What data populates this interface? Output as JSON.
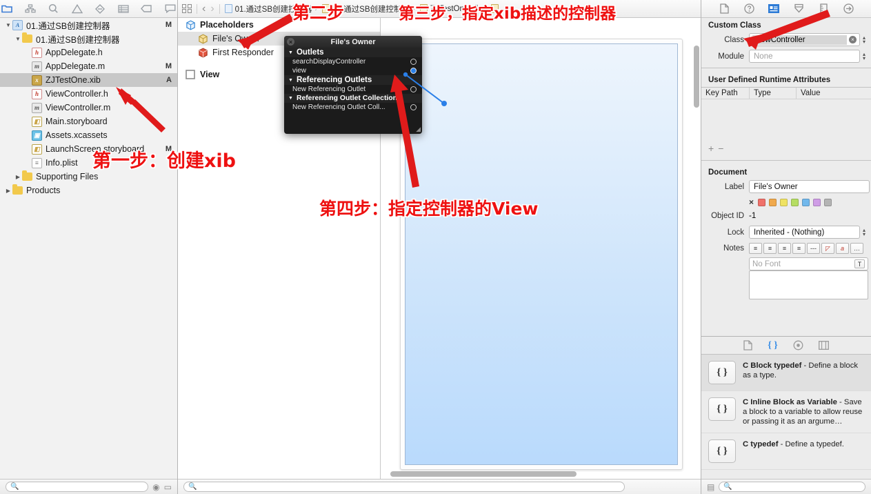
{
  "navigator": {
    "toolbar_icons": [
      "folder-icon",
      "hierarchy-icon",
      "search-icon",
      "warning-icon",
      "issue-icon",
      "test-icon",
      "debug-icon",
      "report-icon"
    ],
    "rows": [
      {
        "name": "01.通过SB创建控制器",
        "status": "M",
        "depth": 0,
        "twisty": "▼",
        "icon": "project-icon"
      },
      {
        "name": "01.通过SB创建控制器",
        "status": "",
        "depth": 1,
        "twisty": "▼",
        "icon": "folder-icon"
      },
      {
        "name": "AppDelegate.h",
        "status": "",
        "depth": 2,
        "twisty": "",
        "icon": "header-file-icon"
      },
      {
        "name": "AppDelegate.m",
        "status": "M",
        "depth": 2,
        "twisty": "",
        "icon": "objc-file-icon"
      },
      {
        "name": "ZJTestOne.xib",
        "status": "A",
        "depth": 2,
        "twisty": "",
        "icon": "xib-file-icon",
        "selected": true
      },
      {
        "name": "ViewController.h",
        "status": "",
        "depth": 2,
        "twisty": "",
        "icon": "header-file-icon"
      },
      {
        "name": "ViewController.m",
        "status": "",
        "depth": 2,
        "twisty": "",
        "icon": "objc-file-icon"
      },
      {
        "name": "Main.storyboard",
        "status": "",
        "depth": 2,
        "twisty": "",
        "icon": "storyboard-file-icon"
      },
      {
        "name": "Assets.xcassets",
        "status": "",
        "depth": 2,
        "twisty": "",
        "icon": "assets-icon"
      },
      {
        "name": "LaunchScreen.storyboard",
        "status": "M",
        "depth": 2,
        "twisty": "",
        "icon": "storyboard-file-icon"
      },
      {
        "name": "Info.plist",
        "status": "",
        "depth": 2,
        "twisty": "",
        "icon": "plist-file-icon"
      },
      {
        "name": "Supporting Files",
        "status": "",
        "depth": 1,
        "twisty": "▶",
        "icon": "folder-icon"
      },
      {
        "name": "Products",
        "status": "",
        "depth": 0,
        "twisty": "▶",
        "icon": "folder-icon"
      }
    ],
    "filter_placeholder": ""
  },
  "editor": {
    "jumpbar": {
      "related_icon": "related-items-icon",
      "back_label": "‹",
      "forward_label": "›",
      "crumbs": [
        {
          "label": "01.通过SB创建控制器",
          "icon": "project-icon"
        },
        {
          "label": "01.通过SB创建控制器",
          "icon": "folder-icon"
        },
        {
          "label": "ZJTestOne.xib",
          "icon": "xib-file-icon"
        },
        {
          "label": "",
          "icon": "placeholders-icon"
        }
      ]
    },
    "outline": [
      {
        "label": "Placeholders",
        "icon": "placeholder-cube-icon",
        "indent": false
      },
      {
        "label": "File's Owner",
        "icon": "files-owner-cube-icon",
        "indent": true,
        "selected": true
      },
      {
        "label": "First Responder",
        "icon": "first-responder-cube-icon",
        "indent": true
      },
      {
        "label": "View",
        "icon": "view-square-icon",
        "indent": false,
        "gap_before": true
      }
    ],
    "filter_placeholder": ""
  },
  "connections_popup": {
    "title": "File's Owner",
    "close_label": "×",
    "sections": [
      {
        "title": "Outlets",
        "twisty": "▼",
        "rows": [
          {
            "label": "searchDisplayController",
            "connected": false
          },
          {
            "label": "view",
            "connected": true
          }
        ]
      },
      {
        "title": "Referencing Outlets",
        "twisty": "▼",
        "rows": [
          {
            "label": "New Referencing Outlet",
            "connected": false
          }
        ]
      },
      {
        "title": "Referencing Outlet Collections",
        "twisty": "▼",
        "rows": [
          {
            "label": "New Referencing Outlet Coll...",
            "connected": false
          }
        ]
      }
    ]
  },
  "inspector": {
    "tabs": [
      "file-inspector-icon",
      "quick-help-icon",
      "identity-inspector-icon",
      "attributes-inspector-icon",
      "size-inspector-icon",
      "connections-inspector-icon"
    ],
    "active_tab_index": 2,
    "custom_class": {
      "title": "Custom Class",
      "class_label": "Class",
      "class_value": "ViewController",
      "module_label": "Module",
      "module_value": "None"
    },
    "runtime_attributes": {
      "title": "User Defined Runtime Attributes",
      "columns": [
        "Key Path",
        "Type",
        "Value"
      ],
      "rows": [],
      "add_label": "+",
      "remove_label": "−"
    },
    "document": {
      "title": "Document",
      "label_label": "Label",
      "label_value": "File's Owner",
      "color_clear": "×",
      "colors": [
        "#f0716a",
        "#f0a94c",
        "#efe262",
        "#b5dd63",
        "#72b8ec",
        "#cf9de6",
        "#b4b4b4"
      ],
      "object_id_label": "Object ID",
      "object_id_value": "-1",
      "lock_label": "Lock",
      "lock_value": "Inherited - (Nothing)",
      "notes_label": "Notes",
      "notes_buttons": [
        "align-left-icon",
        "align-center-icon",
        "align-right-icon",
        "align-justify-icon",
        "dash-icon",
        "image-icon",
        "text-color-icon",
        "more-icon"
      ],
      "font_placeholder": "No Font",
      "font_button": "T",
      "notes_value": ""
    },
    "library": {
      "tabs": [
        "file-template-library-icon",
        "code-snippet-library-icon",
        "object-library-icon",
        "media-library-icon"
      ],
      "active_tab_index": 1,
      "items": [
        {
          "title": "C Block typedef",
          "desc": "- Define a block as a type.",
          "icon": "{ }",
          "selected": true
        },
        {
          "title": "C Inline Block as Variable",
          "desc": "- Save a block to a variable to allow reuse or passing it as an argume…",
          "icon": "{ }",
          "selected": false
        },
        {
          "title": "C typedef",
          "desc": "- Define a typedef.",
          "icon": "{ }",
          "selected": false
        }
      ]
    },
    "filter_placeholder": ""
  },
  "annotations": [
    {
      "id": "step1",
      "text": "第一步：创建xib",
      "color": "#ee1111"
    },
    {
      "id": "step2",
      "text": "第二步",
      "color": "#ee1111"
    },
    {
      "id": "step3",
      "text": "第三步，指定xib描述的控制器",
      "color": "#ee1111"
    },
    {
      "id": "step4",
      "text": "第四步：指定控制器的View",
      "color": "#ee1111"
    }
  ],
  "colors": {
    "accent": "#2d7bd6",
    "annotation": "#ee1111",
    "selection": "#c8c8c8",
    "canvas_view": "#b9dafc"
  }
}
